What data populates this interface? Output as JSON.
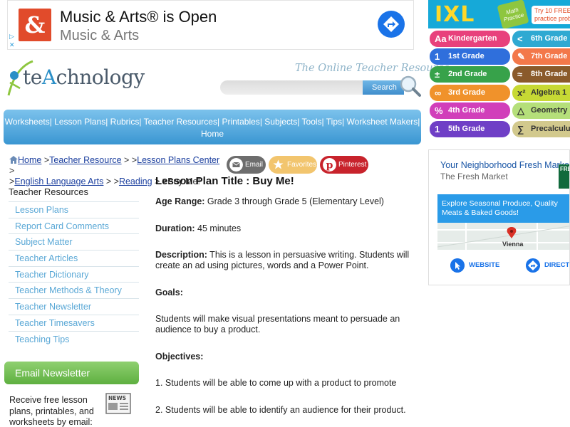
{
  "top_ad": {
    "title": "Music & Arts® is Open",
    "subtitle": "Music & Arts",
    "choices_glyph": "▷ ✕",
    "logo_letter": "&",
    "icons": [
      "music-arts-logo-icon",
      "directions-arrow-icon",
      "adchoices-icon"
    ]
  },
  "site": {
    "logo": {
      "pre": "te",
      "hi": "A",
      "post": "chnology"
    },
    "tagline": "The Online Teacher Resource",
    "search_button": "Search"
  },
  "nav": {
    "items": [
      "Worksheets",
      "Lesson Plans",
      "Rubrics",
      "Teacher Resources",
      "Printables",
      "Subjects",
      "Tools",
      "Tips",
      "Worksheet Makers",
      "Home"
    ]
  },
  "breadcrumb": {
    "home": "Home",
    "teacher_resource": "Teacher Resource",
    "lesson_plans_center": "Lesson Plans Center",
    "english": "English Language Arts",
    "reading": "Reading",
    "current": "Buy Me!",
    "sep1": " >",
    "sep2": " > >",
    "sep3": " >",
    "sep4": ">",
    "sep5": " > >",
    "sep6": " > >"
  },
  "share": {
    "email": "Email",
    "favorites": "Favorites",
    "pinterest": "Pinterest"
  },
  "sidebar": {
    "heading": "Teacher Resources",
    "items": [
      "Lesson Plans",
      "Report Card Comments",
      "Subject Matter",
      "Teacher Articles",
      "Teacher Dictionary",
      "Teacher Methods & Theory",
      "Teacher Newsletter",
      "Teacher Timesavers",
      "Teaching Tips"
    ],
    "newsletter_title": "Email Newsletter",
    "newsletter_text": "Receive free lesson plans, printables, and worksheets by email:",
    "newsletter_icon_label": "NEWS"
  },
  "lesson": {
    "title": "Lesson Plan Title : Buy Me!",
    "age_label": "Age Range:",
    "age_value": " Grade 3 through Grade 5 (Elementary Level)",
    "duration_label": "Duration:",
    "duration_value": " 45 minutes",
    "description_label": "Description:",
    "description_value": " This is a lesson in persuasive writing. Students will create an ad using pictures, words and a Power Point.",
    "goals_label": "Goals:",
    "goals_value": "Students will make visual presentations meant to persuade an audience to buy a product.",
    "objectives_label": "Objectives:",
    "objective_1": "1. Students will be able to come up with a product to promote",
    "objective_2": "2. Students will be able to identify an audience for their product."
  },
  "ixl_ad": {
    "logo": "IXL",
    "badge": "Math Practice",
    "cta_line1": "Try 10 FREE",
    "cta_line2": "practice problems",
    "grades_left": [
      {
        "icon": "Aa",
        "label": "Kindergarten",
        "color": "#e8417c"
      },
      {
        "icon": "1",
        "label": "1st Grade",
        "color": "#2f6fdc"
      },
      {
        "icon": "±",
        "label": "2nd Grade",
        "color": "#37a24a"
      },
      {
        "icon": "∞",
        "label": "3rd Grade",
        "color": "#f0922b"
      },
      {
        "icon": "%",
        "label": "4th Grade",
        "color": "#d13fba"
      },
      {
        "icon": "1",
        "label": "5th Grade",
        "color": "#6f3fc6"
      }
    ],
    "grades_right": [
      {
        "icon": "<",
        "label": "6th Grade",
        "color": "#2fa9d2"
      },
      {
        "icon": "✎",
        "label": "7th Grade",
        "color": "#f3784a"
      },
      {
        "icon": "≈",
        "label": "8th Grade",
        "color": "#8a5a2b"
      },
      {
        "icon": "x²",
        "label": "Algebra 1",
        "color": "#c7d934"
      },
      {
        "icon": "△",
        "label": "Geometry",
        "color": "#b5df7a"
      },
      {
        "icon": "∑",
        "label": "Precalculus",
        "color": "#d2c98d"
      }
    ]
  },
  "market_ad": {
    "title": "Your Neighborhood Fresh Market",
    "subtitle": "The Fresh Market",
    "tile": "FRE",
    "banner": "Explore Seasonal Produce, Quality Meats & Baked Goods!",
    "city": "Vienna",
    "website": "WEBSITE",
    "directions": "DIRECTIONS"
  },
  "colors": {
    "link": "#1a3e9e",
    "sidebar_link": "#5aa8d6",
    "nav_blue": "#3a96d2",
    "newsletter_green": "#5eb040"
  }
}
